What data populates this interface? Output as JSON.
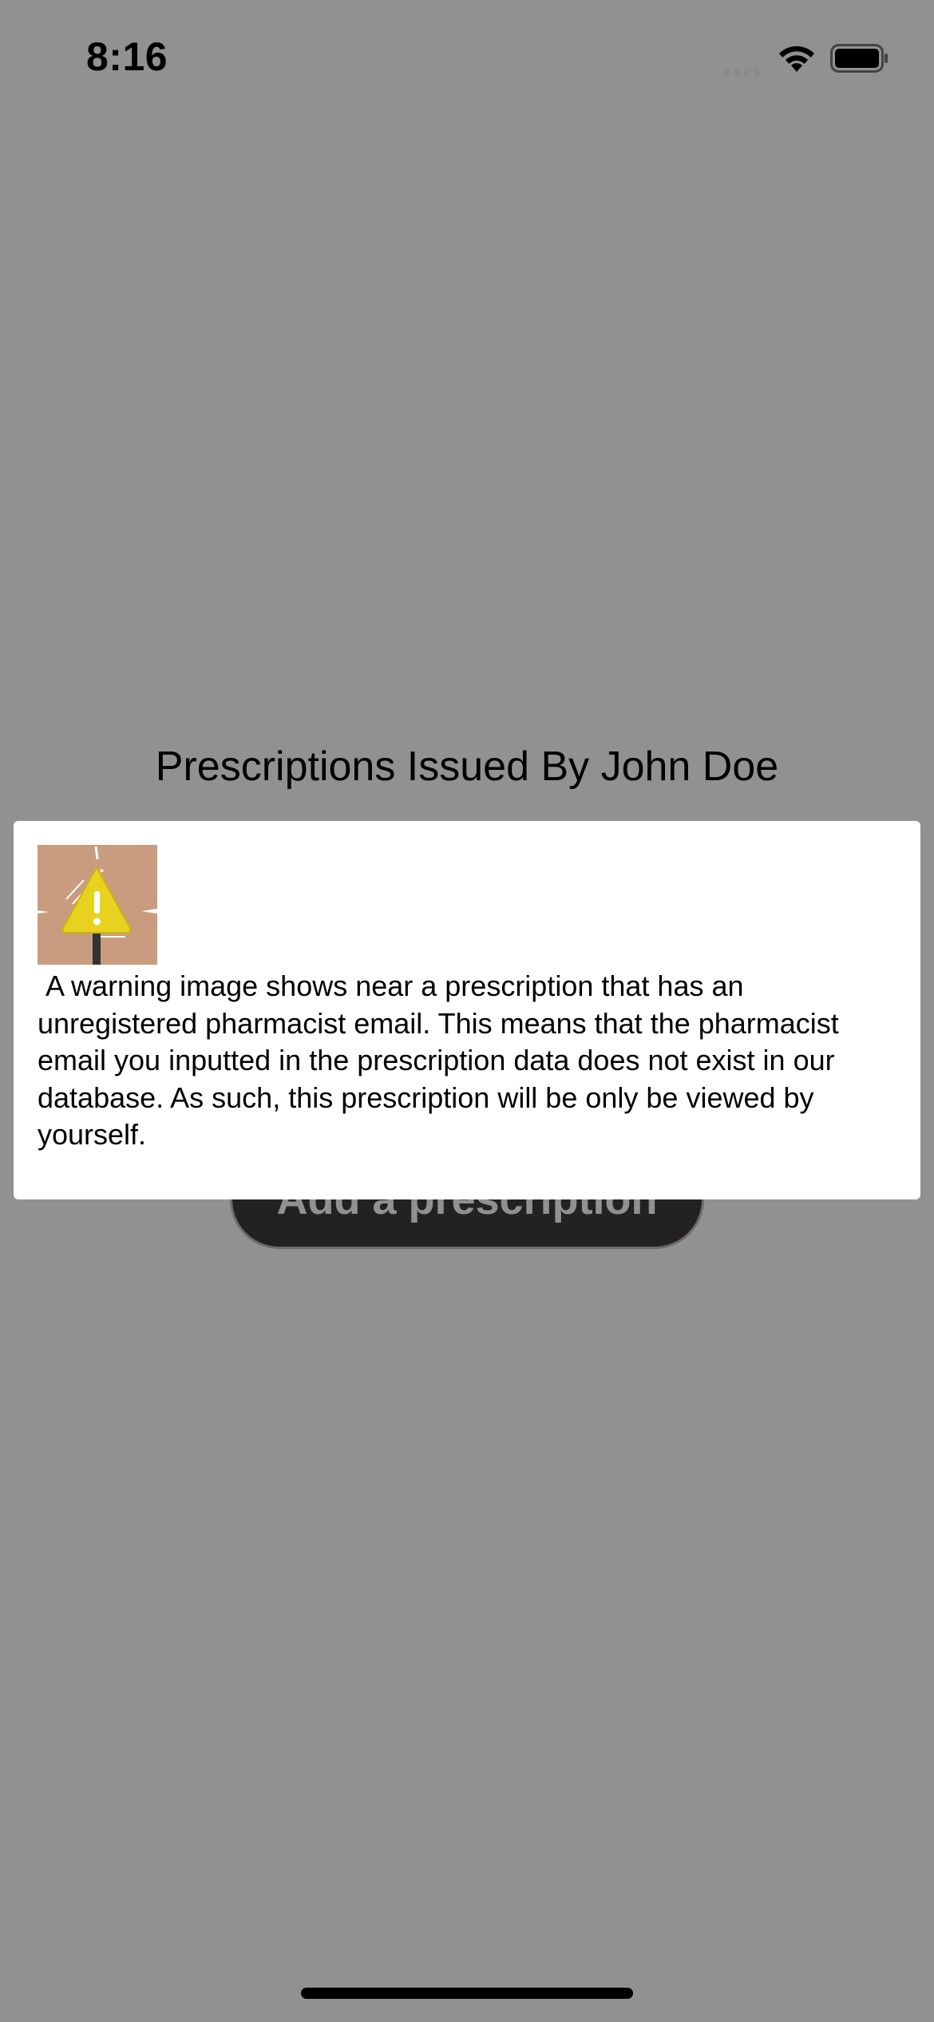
{
  "status_bar": {
    "time": "8:16"
  },
  "screen": {
    "title": "Prescriptions Issued By John Doe",
    "add_button_label": "Add a prescription"
  },
  "modal": {
    "image_icon": "warning-sign-image",
    "text": " A warning image shows near a prescription that has an unregistered pharmacist email. This means that the pharmacist email you inputted in the prescription data does not exist in our database. As such, this prescription will be only be viewed by yourself."
  },
  "colors": {
    "overlay": "#8f8f8f",
    "modal_background": "#ffffff",
    "button_background": "#403b3b",
    "warning_image_background": "#c99c80",
    "warning_sign_yellow": "#e8d21f"
  }
}
